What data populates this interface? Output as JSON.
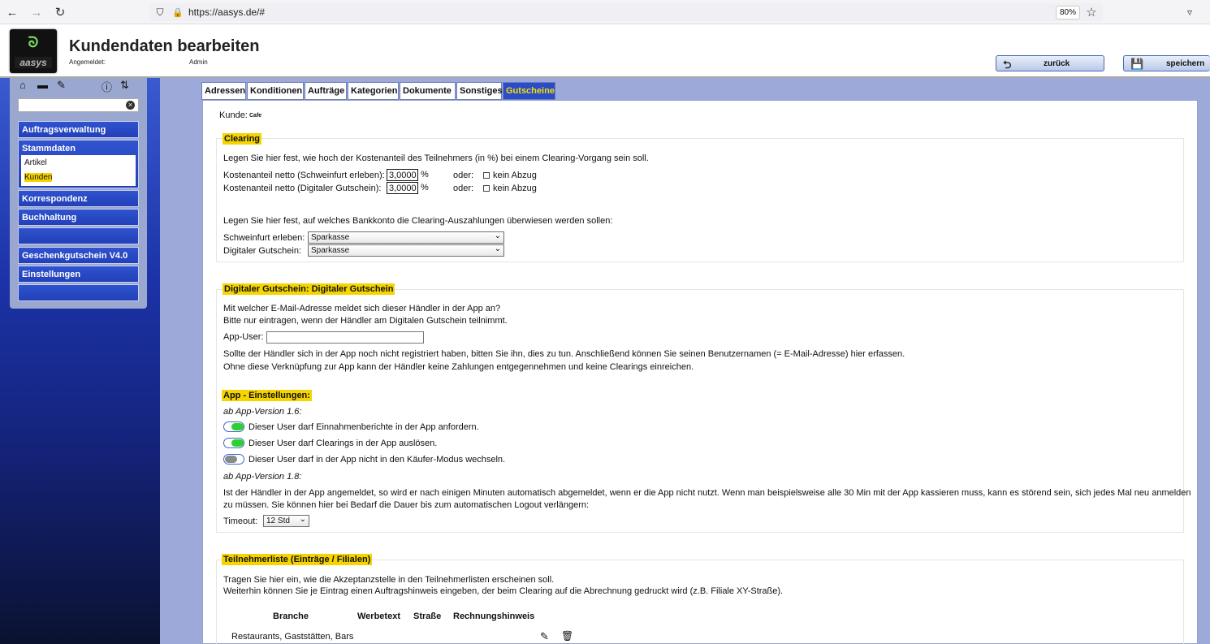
{
  "browser": {
    "url": "https://aasys.de/#",
    "zoom": "80%"
  },
  "header": {
    "logo_text": "aasys",
    "title": "Kundendaten bearbeiten",
    "login_label": "Angemeldet:",
    "login_user": "Admin",
    "back_label": "zurück",
    "save_label": "speichern"
  },
  "sidebar": {
    "search_value": "",
    "menu": [
      {
        "label": "Auftragsverwaltung"
      },
      {
        "label": "Stammdaten"
      },
      {
        "label": "Korrespondenz"
      },
      {
        "label": "Buchhaltung"
      },
      {
        "label": ""
      },
      {
        "label": "Geschenkgutschein V4.0"
      },
      {
        "label": "Einstellungen"
      },
      {
        "label": ""
      }
    ],
    "submenu": [
      "Artikel",
      "Kunden"
    ]
  },
  "tabs": [
    "Adressen",
    "Konditionen",
    "Aufträge",
    "Kategorien",
    "Dokumente",
    "Sonstiges",
    "Gutscheine"
  ],
  "active_tab": "Gutscheine",
  "customer": {
    "label": "Kunde:",
    "value": "Cafe"
  },
  "clearing": {
    "legend": "Clearing",
    "intro": "Legen Sie hier fest, wie hoch der Kostenanteil des Teilnehmers (in %) bei einem Clearing-Vorgang sein soll.",
    "row1_label": "Kostenanteil netto (Schweinfurt erleben):",
    "row1_value": "3,0000",
    "row2_label": "Kostenanteil netto (Digitaler Gutschein):",
    "row2_value": "3,0000",
    "percent": "%",
    "oder": "oder:",
    "no_deduction": "kein Abzug",
    "bank_intro": "Legen Sie hier fest, auf welches Bankkonto die Clearing-Auszahlungen überwiesen werden sollen:",
    "bank1_label": "Schweinfurt erleben:",
    "bank1_value": "Sparkasse",
    "bank2_label": "Digitaler Gutschein:",
    "bank2_value": "Sparkasse"
  },
  "digital": {
    "legend": "Digitaler Gutschein: Digitaler Gutschein",
    "line1": "Mit welcher E-Mail-Adresse meldet sich dieser Händler in der App an?",
    "line2": "Bitte nur eintragen, wenn der Händler am Digitalen Gutschein teilnimmt.",
    "app_user_label": "App-User:",
    "app_user_value": "",
    "line3": "Sollte der Händler sich in der App noch nicht registriert haben, bitten Sie ihn, dies zu tun. Anschließend können Sie seinen Benutzernamen (= E-Mail-Adresse) hier erfassen.",
    "line4": "Ohne diese Verknüpfung zur App kann der Händler keine Zahlungen entgegennehmen und keine Clearings einreichen.",
    "app_settings": "App - Einstellungen:",
    "version16": "ab App-Version 1.6:",
    "toggle1_label": "Dieser User darf Einnahmenberichte in der App anfordern.",
    "toggle1_on": true,
    "toggle2_label": "Dieser User darf Clearings in der App auslösen.",
    "toggle2_on": true,
    "toggle3_label": "Dieser User darf in der App nicht in den Käufer-Modus wechseln.",
    "toggle3_on": false,
    "version18": "ab App-Version 1.8:",
    "logout1": "Ist der Händler in der App angemeldet, so wird er nach einigen Minuten automatisch abgemeldet, wenn er die App nicht nutzt. Wenn man beispielsweise alle 30 Min mit der App kassieren muss, kann es störend sein, sich jedes Mal neu anmelden",
    "logout2": "zu müssen. Sie können hier bei Bedarf die Dauer bis zum automatischen Logout verlängern:",
    "timeout_label": "Timeout:",
    "timeout_value": "12 Std"
  },
  "participants": {
    "legend": "Teilnehmerliste (Einträge / Filialen)",
    "line1": "Tragen Sie hier ein, wie die Akzeptanzstelle in den Teilnehmerlisten erscheinen soll.",
    "line2": "Weiterhin können Sie je Eintrag einen Auftragshinweis eingeben, der beim Clearing auf die Abrechnung gedruckt wird (z.B. Filiale XY-Straße).",
    "columns": [
      "Branche",
      "Werbetext",
      "Straße",
      "Rechnungshinweis"
    ],
    "rows": [
      {
        "branche": "Restaurants, Gaststätten, Bars"
      }
    ]
  }
}
